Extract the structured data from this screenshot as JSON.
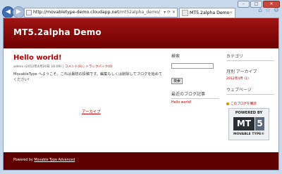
{
  "browser": {
    "url_host": "http://movabletype-demo.cloudapp.net",
    "url_path": "/mt52alpha_demo/",
    "tab_title": "MT5.2alpha Demo",
    "address_tools": "▾ ⟳ ✕"
  },
  "site": {
    "title": "MT5.2alpha Demo"
  },
  "entry": {
    "title": "Hello world!",
    "meta_text": "admin (2012年4月20日 16:09) | ",
    "comments_link": "コメント(0)",
    "trackbacks_link": "トラックバック(0)",
    "body": "MovableType へようこそ。これは最初の投稿です。編集もしくは削除してブログを始めてください!",
    "archive_link": "アーカイブ"
  },
  "sidebar": {
    "search_heading": "検索",
    "search_button": "検索",
    "recent_heading": "最近のブログ記事",
    "recent_item": "Hello world!",
    "category_heading": "カテゴリ",
    "monthly_heading": "月別 アーカイブ",
    "monthly_item": "2012年4月 (1)",
    "web_heading": "ウェブページ",
    "about_link": "このブログを購読"
  },
  "badge": {
    "powered_by": "POWERED BY",
    "mt": "MT",
    "five": "5",
    "movable_type": "MOVABLE TYPE®"
  },
  "footer": {
    "prefix": "Powered by",
    "link": "Movable Type Advanced"
  }
}
